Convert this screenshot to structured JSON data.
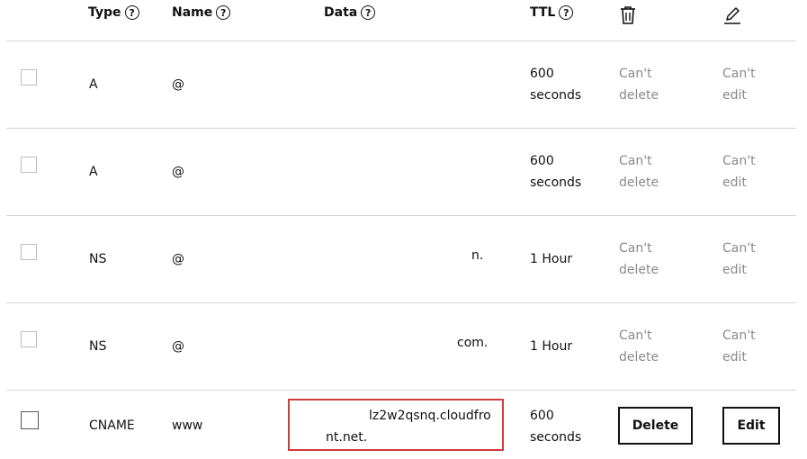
{
  "headers": {
    "type": "Type",
    "name": "Name",
    "data": "Data",
    "ttl": "TTL"
  },
  "records": [
    {
      "type": "A",
      "name": "@",
      "data": "",
      "ttl_line1": "600",
      "ttl_line2": "seconds",
      "delete_line1": "Can't",
      "delete_line2": "delete",
      "edit_line1": "Can't",
      "edit_line2": "edit"
    },
    {
      "type": "A",
      "name": "@",
      "data": "",
      "ttl_line1": "600",
      "ttl_line2": "seconds",
      "delete_line1": "Can't",
      "delete_line2": "delete",
      "edit_line1": "Can't",
      "edit_line2": "edit"
    },
    {
      "type": "NS",
      "name": "@",
      "data": "n.",
      "ttl": "1 Hour",
      "delete_line1": "Can't",
      "delete_line2": "delete",
      "edit_line1": "Can't",
      "edit_line2": "edit"
    },
    {
      "type": "NS",
      "name": "@",
      "data": "com.",
      "ttl": "1 Hour",
      "delete_line1": "Can't",
      "delete_line2": "delete",
      "edit_line1": "Can't",
      "edit_line2": "edit"
    },
    {
      "type": "CNAME",
      "name": "www",
      "data_line1": "lz2w2qsnq.cloudfro",
      "data_line2": "nt.net.",
      "ttl_line1": "600",
      "ttl_line2": "seconds",
      "delete_label": "Delete",
      "edit_label": "Edit"
    }
  ],
  "icons": {
    "help": "question-circle-icon",
    "delete_column": "trash-icon",
    "edit_column": "pencil-icon"
  },
  "colors": {
    "highlight": "#d23b3b",
    "muted_text": "#8a8a8a"
  }
}
